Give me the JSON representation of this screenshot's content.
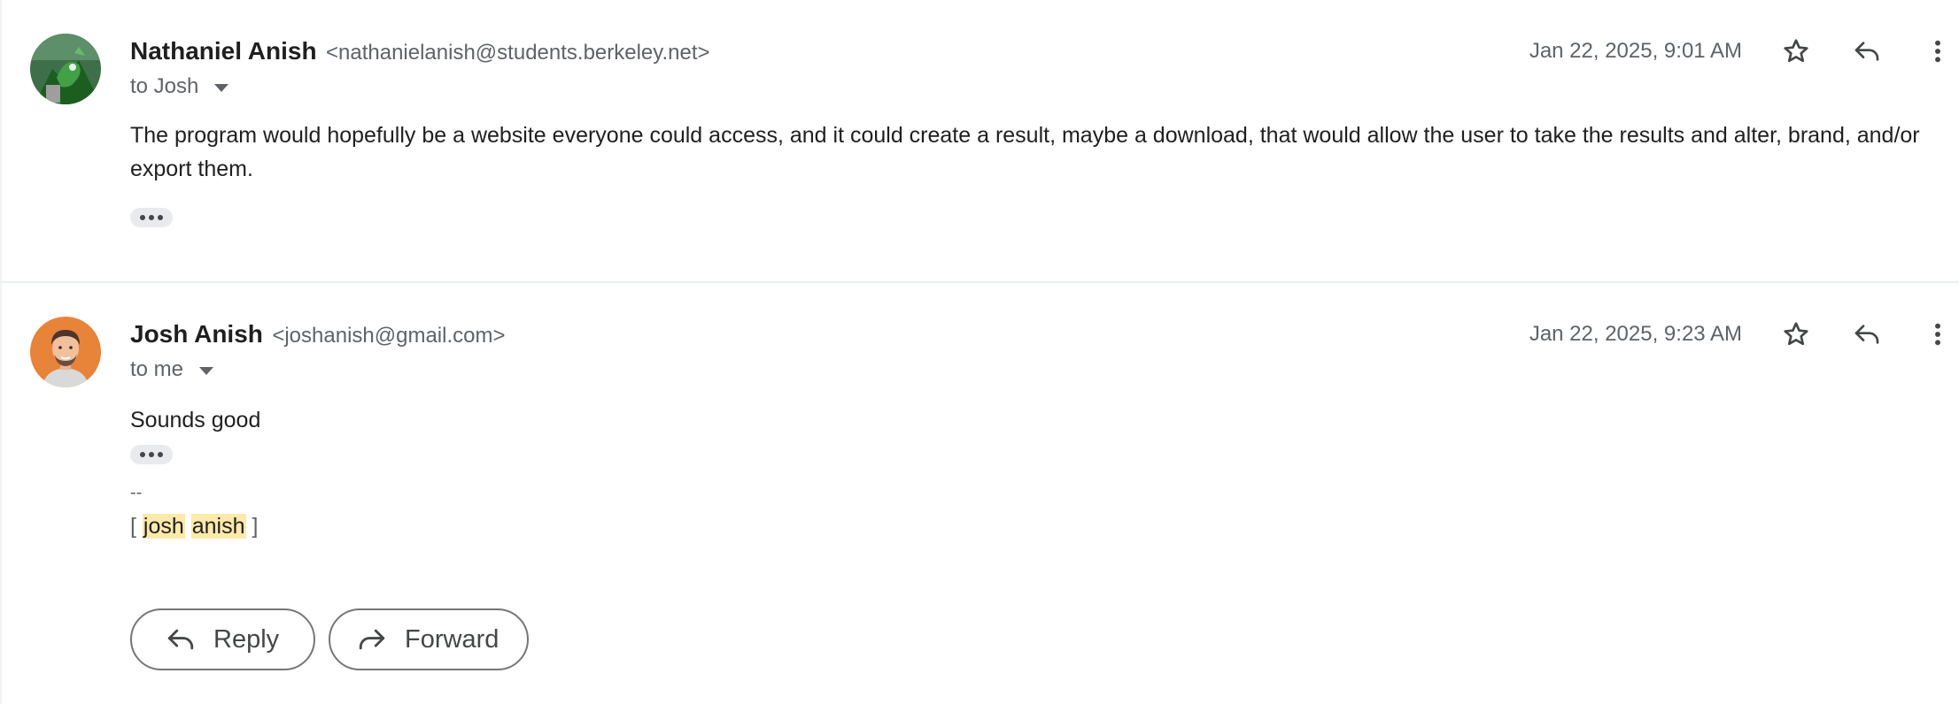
{
  "messages": [
    {
      "sender_name": "Nathaniel Anish",
      "sender_email": "<nathanielanish@students.berkeley.net>",
      "recipient": "to Josh",
      "date": "Jan 22, 2025, 9:01 AM",
      "body": "The program would hopefully be a website everyone could access, and it could create a result, maybe a download, that would allow the user to take the results and alter, brand, and/or export them."
    },
    {
      "sender_name": "Josh Anish",
      "sender_email": "<joshanish@gmail.com>",
      "recipient": "to me",
      "date": "Jan 22, 2025, 9:23 AM",
      "body": "Sounds good",
      "signature_separator": "--",
      "signature": {
        "open": "[",
        "first": "josh",
        "last": "anish",
        "close": "]"
      }
    }
  ],
  "actions": {
    "reply_label": "Reply",
    "forward_label": "Forward"
  },
  "colors": {
    "text": "#1f1f1f",
    "secondary": "#5f6368",
    "highlight": "#fde9a9",
    "avatar1": "#2e7d32",
    "avatar2": "#e8833a"
  }
}
